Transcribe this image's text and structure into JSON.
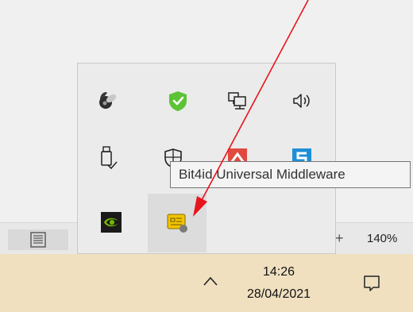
{
  "tray": {
    "icons": [
      "speaker-satellite-icon",
      "green-check-shield-icon",
      "network-icon",
      "volume-icon",
      "usb-drive-icon",
      "security-shield-icon",
      "red-app-icon",
      "blue-app-icon",
      "nvidia-icon",
      "smartcard-icon"
    ],
    "tooltip": "Bit4id Universal Middleware"
  },
  "statusbar": {
    "plus": "+",
    "zoom": "140%"
  },
  "taskbar": {
    "time": "14:26",
    "date": "28/04/2021"
  },
  "colors": {
    "taskbar": "#f0e0c0",
    "flyout": "#ebebeb",
    "annotation_arrow": "#e8141c",
    "green_shield": "#5cc334",
    "nvidia_green": "#76b900",
    "smartcard_gold": "#f2c300"
  }
}
